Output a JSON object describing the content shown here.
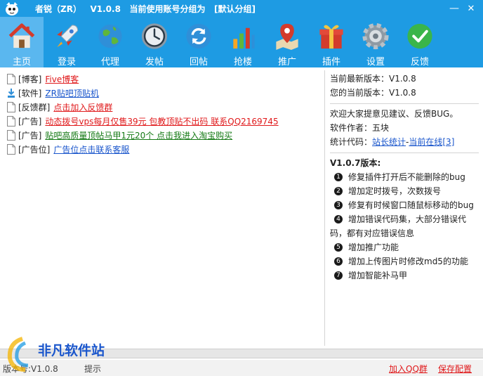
{
  "window": {
    "title": "者锐（ZR）   V1.0.8   当前使用账号分组为   [默认分组]",
    "minimize": "—",
    "close": "✕"
  },
  "toolbar": [
    {
      "label": "主页",
      "icon": "home-icon",
      "active": true
    },
    {
      "label": "登录",
      "icon": "rocket-icon",
      "active": false
    },
    {
      "label": "代理",
      "icon": "globe-icon",
      "active": false
    },
    {
      "label": "发帖",
      "icon": "clock-icon",
      "active": false
    },
    {
      "label": "回帖",
      "icon": "refresh-icon",
      "active": false
    },
    {
      "label": "抢楼",
      "icon": "bar-chart-icon",
      "active": false
    },
    {
      "label": "推广",
      "icon": "map-pin-icon",
      "active": false
    },
    {
      "label": "插件",
      "icon": "gift-icon",
      "active": false
    },
    {
      "label": "设置",
      "icon": "gear-icon",
      "active": false
    },
    {
      "label": "反馈",
      "icon": "checkmark-icon",
      "active": false
    }
  ],
  "links": [
    {
      "tag": "[博客]",
      "text": "Five博客",
      "color": "#e0191b",
      "icon": "document-icon"
    },
    {
      "tag": "[软件]",
      "text": "ZR贴吧顶贴机",
      "color": "#1a56cc",
      "icon": "download-icon"
    },
    {
      "tag": "[反馈群]",
      "text": "点击加入反馈群",
      "color": "#e0191b",
      "icon": "document-icon"
    },
    {
      "tag": "[广告]",
      "text": "动态拨号vps每月仅售39元 包教顶贴不出码 联系QQ2169745",
      "color": "#e0191b",
      "icon": "document-icon"
    },
    {
      "tag": "[广告]",
      "text": "贴吧高质量顶帖马甲1元20个 点击我进入淘宝购买",
      "color": "#157a15",
      "icon": "document-icon"
    },
    {
      "tag": "[广告位]",
      "text": "广告位点击联系客服",
      "color": "#1a56cc",
      "icon": "document-icon"
    }
  ],
  "info": {
    "latest": "当前最新版本：V1.0.8",
    "current": "您的当前版本：V1.0.8",
    "welcome": "欢迎大家提意见建议、反馈BUG。",
    "author": "软件作者：五块",
    "stats_label": "统计代码：",
    "stats_link1": "站长统计",
    "stats_sep": "-",
    "stats_link2": "当前在线[3]"
  },
  "changelog": {
    "title": "V1.0.7版本:",
    "items": [
      {
        "num": "1",
        "text": "修复插件打开后不能删除的bug"
      },
      {
        "num": "2",
        "text": "增加定时拨号，次数拨号"
      },
      {
        "num": "3",
        "text": "修复有时候窗口随鼠标移动的bug"
      },
      {
        "num": "4",
        "text": "增加错误代码集，大部分错误代",
        "cont": "码，都有对应错误信息"
      },
      {
        "num": "5",
        "text": "增加推广功能"
      },
      {
        "num": "6",
        "text": "增加上传图片时修改md5的功能"
      },
      {
        "num": "7",
        "text": "增加智能补马甲"
      }
    ]
  },
  "statusbar": {
    "version": "版本号:V1.0.8",
    "tip": "提示",
    "join_qq": "加入QQ群",
    "save": "保存配置"
  },
  "watermark": {
    "text": "非凡软件站"
  },
  "colors": {
    "accent": "#1e9be3",
    "active_tab": "#5ab7ef",
    "link_red": "#e0191b",
    "link_blue": "#1a56cc",
    "link_green": "#157a15"
  }
}
